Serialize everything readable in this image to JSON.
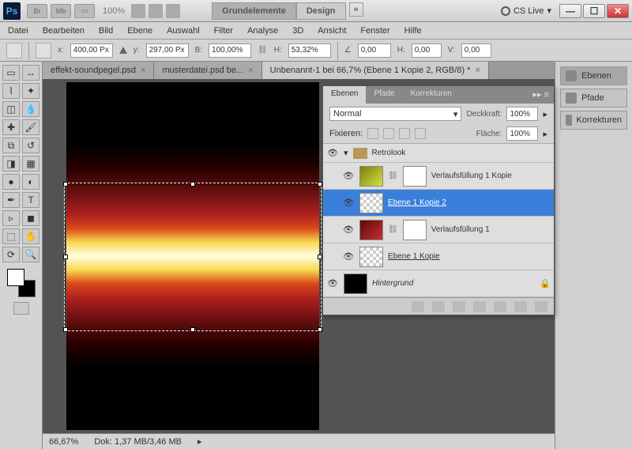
{
  "top": {
    "zoom": "100%",
    "center_tabs": [
      "Grundelemente",
      "Design"
    ],
    "cslive": "CS Live"
  },
  "menu": [
    "Datei",
    "Bearbeiten",
    "Bild",
    "Ebene",
    "Auswahl",
    "Filter",
    "Analyse",
    "3D",
    "Ansicht",
    "Fenster",
    "Hilfe"
  ],
  "options": {
    "x": "400,00 Px",
    "y": "297,00 Px",
    "w": "100,00%",
    "h": "53,32%",
    "angle": "0,00",
    "hskew": "0,00",
    "vskew": "0,00",
    "xl": "x:",
    "yl": "y:",
    "wl": "B:",
    "hl": "H:",
    "al": "H:",
    "vl": "V:"
  },
  "doc_tabs": [
    {
      "label": "effekt-soundpegel.psd",
      "active": false
    },
    {
      "label": "musterdatei.psd be...",
      "active": false
    },
    {
      "label": "Unbenannt-1 bei 66,7% (Ebene 1 Kopie 2, RGB/8) *",
      "active": true
    }
  ],
  "status": {
    "zoom": "66,67%",
    "doc": "Dok: 1,37 MB/3,46 MB"
  },
  "panel": {
    "tabs": [
      "Ebenen",
      "Pfade",
      "Korrekturen"
    ],
    "blend": "Normal",
    "opacity_label": "Deckkraft:",
    "opacity": "100%",
    "fill_label": "Fläche:",
    "fill": "100%",
    "lock_label": "Fixieren:",
    "group": "Retrolook",
    "layers": [
      {
        "name": "Verlaufsfüllung 1 Kopie",
        "thumb": "yellow",
        "mask": true,
        "sel": false
      },
      {
        "name": "Ebene 1 Kopie 2",
        "thumb": "checker",
        "mask": false,
        "sel": true
      },
      {
        "name": "Verlaufsfüllung 1",
        "thumb": "red",
        "mask": true,
        "sel": false
      },
      {
        "name": "Ebene 1 Kopie",
        "thumb": "checker",
        "mask": false,
        "sel": false
      }
    ],
    "bg": "Hintergrund"
  },
  "side": [
    {
      "label": "Ebenen",
      "active": true
    },
    {
      "label": "Pfade",
      "active": false
    },
    {
      "label": "Korrekturen",
      "active": false
    }
  ]
}
